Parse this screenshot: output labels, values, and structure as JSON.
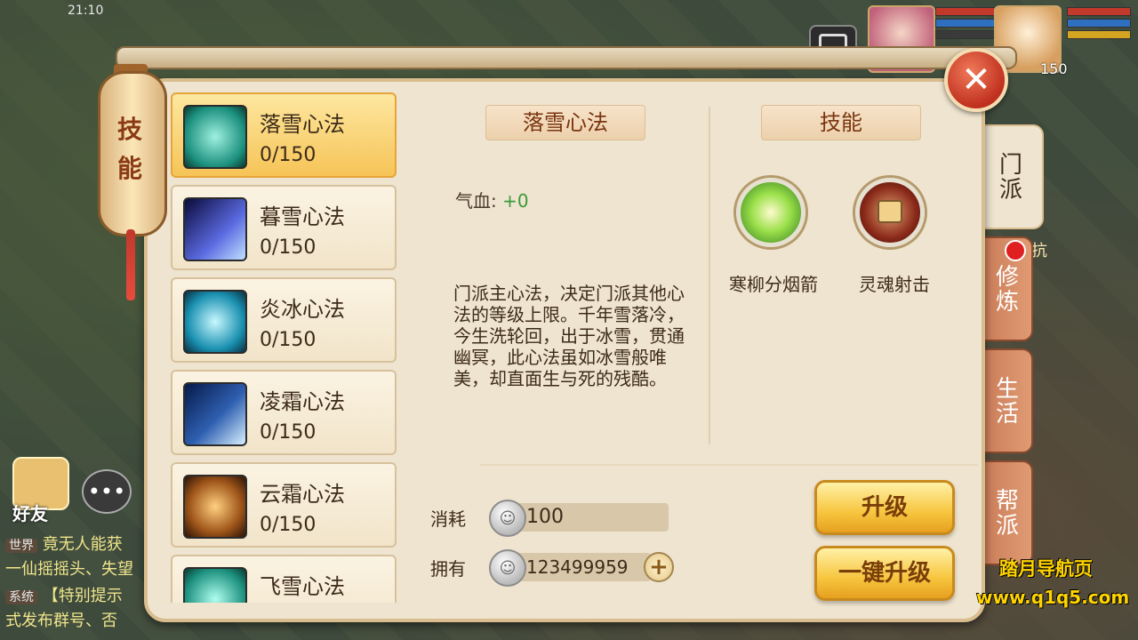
{
  "status": {
    "time": "21:10"
  },
  "header": {
    "lantern_title": "技能",
    "close_icon": "close-icon"
  },
  "skill_list": [
    {
      "name": "落雪心法",
      "level": "0/150",
      "selected": true,
      "color": "#1b8f7d"
    },
    {
      "name": "暮雪心法",
      "level": "0/150",
      "selected": false,
      "color": "#2a3a8a"
    },
    {
      "name": "炎冰心法",
      "level": "0/150",
      "selected": false,
      "color": "#1a90b0"
    },
    {
      "name": "凌霜心法",
      "level": "0/150",
      "selected": false,
      "color": "#2f5fb0"
    },
    {
      "name": "云霜心法",
      "level": "0/150",
      "selected": false,
      "color": "#a0561a"
    },
    {
      "name": "飞雪心法",
      "level": "",
      "selected": false,
      "color": "#1b8f7d"
    }
  ],
  "detail": {
    "title": "落雪心法",
    "attr_label": "气血:",
    "attr_value": "+0",
    "description": "门派主心法，决定门派其他心法的等级上限。千年雪落冷，今生洗轮回，出于冰雪，贯通幽冥，此心法虽如冰雪般唯美，却直面生与死的残酷。"
  },
  "skills_panel": {
    "title": "技能",
    "skills": [
      {
        "name": "寒柳分烟箭",
        "locked": false
      },
      {
        "name": "灵魂射击",
        "locked": true
      }
    ]
  },
  "cost": {
    "cost_label": "消耗",
    "cost_value": "100",
    "own_label": "拥有",
    "own_value": "123499959"
  },
  "buttons": {
    "upgrade": "升级",
    "upgrade_all": "一键升级"
  },
  "tabs": [
    {
      "label": "门派",
      "active": true
    },
    {
      "label": "修炼",
      "active": false
    },
    {
      "label": "生活",
      "active": false
    },
    {
      "label": "帮派",
      "active": false
    }
  ],
  "background": {
    "friend_label": "好友",
    "chat": [
      {
        "tag": "世界",
        "text": "竟无人能获"
      },
      {
        "tag": "",
        "text": "一仙摇摇头、失望"
      },
      {
        "tag": "系统",
        "text": "【特别提示"
      },
      {
        "tag": "",
        "text": "式发布群号、否"
      }
    ],
    "player_level": "150",
    "hint": "抗"
  },
  "watermark": {
    "line1": "踏月导航页",
    "line2": "www.q1q5.com"
  }
}
